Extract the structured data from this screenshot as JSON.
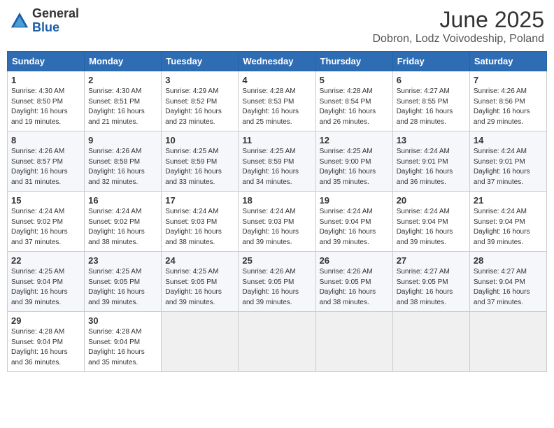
{
  "header": {
    "logo_general": "General",
    "logo_blue": "Blue",
    "month_year": "June 2025",
    "location": "Dobron, Lodz Voivodeship, Poland"
  },
  "weekdays": [
    "Sunday",
    "Monday",
    "Tuesday",
    "Wednesday",
    "Thursday",
    "Friday",
    "Saturday"
  ],
  "weeks": [
    [
      {
        "day": "1",
        "info": "Sunrise: 4:30 AM\nSunset: 8:50 PM\nDaylight: 16 hours\nand 19 minutes."
      },
      {
        "day": "2",
        "info": "Sunrise: 4:30 AM\nSunset: 8:51 PM\nDaylight: 16 hours\nand 21 minutes."
      },
      {
        "day": "3",
        "info": "Sunrise: 4:29 AM\nSunset: 8:52 PM\nDaylight: 16 hours\nand 23 minutes."
      },
      {
        "day": "4",
        "info": "Sunrise: 4:28 AM\nSunset: 8:53 PM\nDaylight: 16 hours\nand 25 minutes."
      },
      {
        "day": "5",
        "info": "Sunrise: 4:28 AM\nSunset: 8:54 PM\nDaylight: 16 hours\nand 26 minutes."
      },
      {
        "day": "6",
        "info": "Sunrise: 4:27 AM\nSunset: 8:55 PM\nDaylight: 16 hours\nand 28 minutes."
      },
      {
        "day": "7",
        "info": "Sunrise: 4:26 AM\nSunset: 8:56 PM\nDaylight: 16 hours\nand 29 minutes."
      }
    ],
    [
      {
        "day": "8",
        "info": "Sunrise: 4:26 AM\nSunset: 8:57 PM\nDaylight: 16 hours\nand 31 minutes."
      },
      {
        "day": "9",
        "info": "Sunrise: 4:26 AM\nSunset: 8:58 PM\nDaylight: 16 hours\nand 32 minutes."
      },
      {
        "day": "10",
        "info": "Sunrise: 4:25 AM\nSunset: 8:59 PM\nDaylight: 16 hours\nand 33 minutes."
      },
      {
        "day": "11",
        "info": "Sunrise: 4:25 AM\nSunset: 8:59 PM\nDaylight: 16 hours\nand 34 minutes."
      },
      {
        "day": "12",
        "info": "Sunrise: 4:25 AM\nSunset: 9:00 PM\nDaylight: 16 hours\nand 35 minutes."
      },
      {
        "day": "13",
        "info": "Sunrise: 4:24 AM\nSunset: 9:01 PM\nDaylight: 16 hours\nand 36 minutes."
      },
      {
        "day": "14",
        "info": "Sunrise: 4:24 AM\nSunset: 9:01 PM\nDaylight: 16 hours\nand 37 minutes."
      }
    ],
    [
      {
        "day": "15",
        "info": "Sunrise: 4:24 AM\nSunset: 9:02 PM\nDaylight: 16 hours\nand 37 minutes."
      },
      {
        "day": "16",
        "info": "Sunrise: 4:24 AM\nSunset: 9:02 PM\nDaylight: 16 hours\nand 38 minutes."
      },
      {
        "day": "17",
        "info": "Sunrise: 4:24 AM\nSunset: 9:03 PM\nDaylight: 16 hours\nand 38 minutes."
      },
      {
        "day": "18",
        "info": "Sunrise: 4:24 AM\nSunset: 9:03 PM\nDaylight: 16 hours\nand 39 minutes."
      },
      {
        "day": "19",
        "info": "Sunrise: 4:24 AM\nSunset: 9:04 PM\nDaylight: 16 hours\nand 39 minutes."
      },
      {
        "day": "20",
        "info": "Sunrise: 4:24 AM\nSunset: 9:04 PM\nDaylight: 16 hours\nand 39 minutes."
      },
      {
        "day": "21",
        "info": "Sunrise: 4:24 AM\nSunset: 9:04 PM\nDaylight: 16 hours\nand 39 minutes."
      }
    ],
    [
      {
        "day": "22",
        "info": "Sunrise: 4:25 AM\nSunset: 9:04 PM\nDaylight: 16 hours\nand 39 minutes."
      },
      {
        "day": "23",
        "info": "Sunrise: 4:25 AM\nSunset: 9:05 PM\nDaylight: 16 hours\nand 39 minutes."
      },
      {
        "day": "24",
        "info": "Sunrise: 4:25 AM\nSunset: 9:05 PM\nDaylight: 16 hours\nand 39 minutes."
      },
      {
        "day": "25",
        "info": "Sunrise: 4:26 AM\nSunset: 9:05 PM\nDaylight: 16 hours\nand 39 minutes."
      },
      {
        "day": "26",
        "info": "Sunrise: 4:26 AM\nSunset: 9:05 PM\nDaylight: 16 hours\nand 38 minutes."
      },
      {
        "day": "27",
        "info": "Sunrise: 4:27 AM\nSunset: 9:05 PM\nDaylight: 16 hours\nand 38 minutes."
      },
      {
        "day": "28",
        "info": "Sunrise: 4:27 AM\nSunset: 9:04 PM\nDaylight: 16 hours\nand 37 minutes."
      }
    ],
    [
      {
        "day": "29",
        "info": "Sunrise: 4:28 AM\nSunset: 9:04 PM\nDaylight: 16 hours\nand 36 minutes."
      },
      {
        "day": "30",
        "info": "Sunrise: 4:28 AM\nSunset: 9:04 PM\nDaylight: 16 hours\nand 35 minutes."
      },
      {
        "day": "",
        "info": ""
      },
      {
        "day": "",
        "info": ""
      },
      {
        "day": "",
        "info": ""
      },
      {
        "day": "",
        "info": ""
      },
      {
        "day": "",
        "info": ""
      }
    ]
  ]
}
